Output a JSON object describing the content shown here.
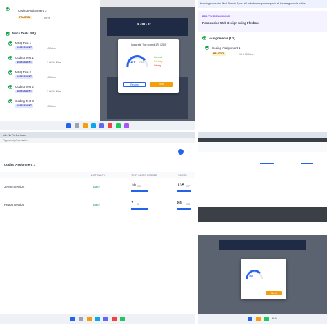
{
  "q1": {
    "top_item": {
      "title": "Coding Assignment 3",
      "badge": "PRACTICE",
      "meta": "6 Hrs"
    },
    "section_assignments_header": "Assignments (1/1)",
    "section_mock_header": "Mock Tests (5/5)",
    "items": [
      {
        "title": "MCQ Test 1",
        "badge": "ASSESSMENT",
        "meta": "45 Mins"
      },
      {
        "title": "Coding Test 1",
        "badge": "ASSESSMENT",
        "meta": "1 Hr 30 Mins"
      },
      {
        "title": "MCQ Test 2",
        "badge": "ASSESSMENT",
        "meta": "45 Mins"
      },
      {
        "title": "Coding Test 2",
        "badge": "ASSESSMENT",
        "meta": "1 Hr 30 Mins"
      },
      {
        "title": "Coding Test 3",
        "badge": "ASSESSMENT",
        "meta": "45 Mins"
      }
    ],
    "overlay": {
      "timer": "4 : 58 : 37",
      "modal_title": "Congrats! You scored 170 / 200",
      "score": "170",
      "score_total": "/200",
      "legend": [
        "Correct",
        "Partially",
        "Wrong"
      ],
      "button_primary": "Next",
      "button_secondary": "Review"
    }
  },
  "q2": {
    "banner": "Learning content of Next Growth Cycle will unlock once you complete all the assignments in this",
    "section_label": "PRACTICE BY NXWAVE",
    "title": "Responsive Web Design using Flexbox",
    "assignments_header": "Assignments (1/1)",
    "item": {
      "title": "Coding Assignment 1",
      "badge": "PRACTICE",
      "meta": "1 Hr 30 Mins"
    }
  },
  "q3": {
    "tab_title": "with No Perfect Love",
    "url": "Opportunity?courseId=...",
    "page_title": "Coding Assignment 1",
    "columns": [
      "DIFFICULTY",
      "TEST CASES PASSED",
      "SCORE"
    ],
    "rows": [
      {
        "name": "Jewish Section",
        "difficulty": "Easy",
        "tests": "10",
        "tests_total": "/10",
        "score": "135",
        "score_total": "/17"
      },
      {
        "name": "Report Section",
        "difficulty": "Easy",
        "tests": "7",
        "tests_total": "/8",
        "score": "80",
        "score_total": "/95"
      }
    ]
  },
  "q4": {
    "modal_score": "160",
    "taskbar_time": "6:24"
  },
  "colors": {
    "accent": "#2563eb",
    "success": "#16a34a",
    "warning": "#f59e0b"
  }
}
